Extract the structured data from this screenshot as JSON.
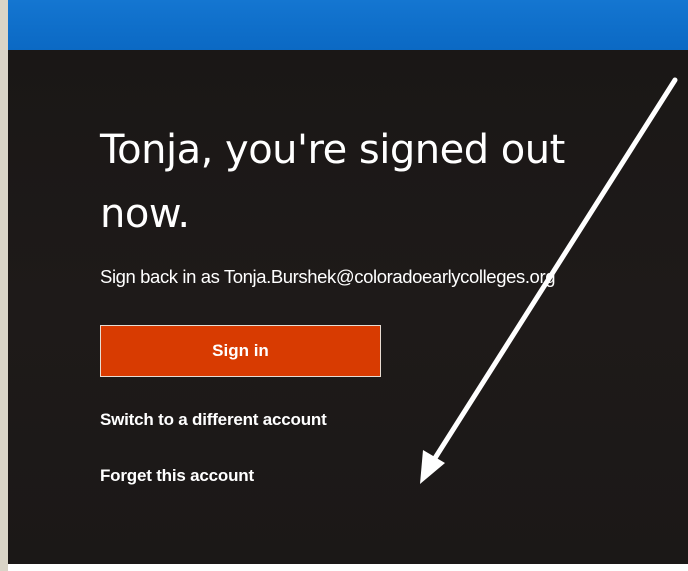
{
  "signout": {
    "heading": "Tonja, you're signed out now.",
    "subtext": "Sign back in as Tonja.Burshek@coloradoearlycolleges.org",
    "sign_in_label": "Sign in",
    "switch_account_label": "Switch to a different account",
    "forget_account_label": "Forget this account"
  },
  "colors": {
    "top_bar": "#0b69c4",
    "background": "#1a1716",
    "sign_in_button": "#d83b01",
    "text": "#ffffff",
    "annotation_arrow": "#ffffff"
  },
  "annotation": {
    "icon": "arrow-annotation-icon",
    "points_to": "Switch to a different account"
  }
}
